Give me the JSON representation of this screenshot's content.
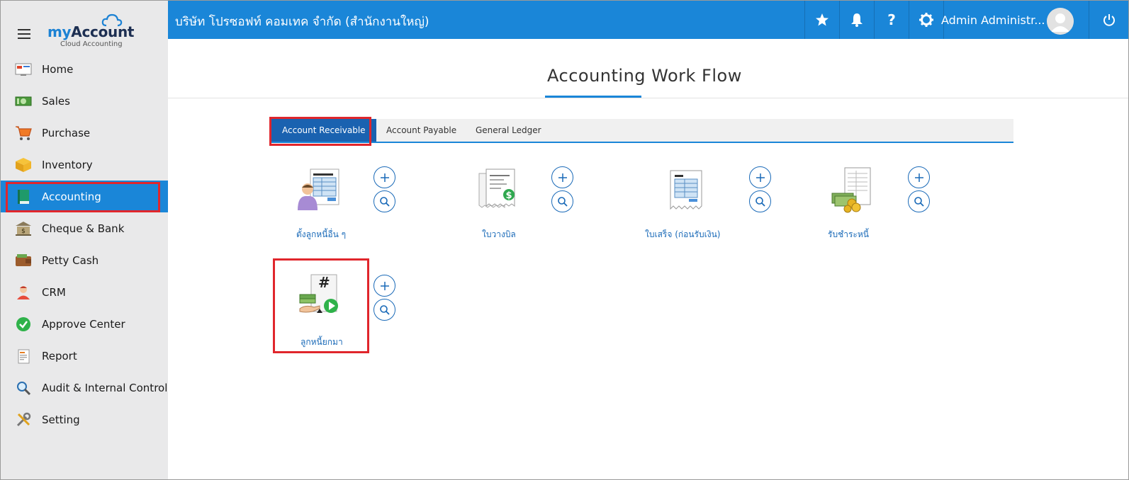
{
  "logo": {
    "brand_my": "my",
    "brand_account": "Account",
    "tagline": "Cloud Accounting"
  },
  "header": {
    "company": "บริษัท โปรซอฟท์ คอมเทค จำกัด (สำนักงานใหญ่)",
    "user_name": "Admin Administr...",
    "icons": [
      "star-icon",
      "bell-icon",
      "help-icon",
      "gear-icon",
      "power-icon"
    ]
  },
  "sidebar": {
    "items": [
      {
        "label": "Home",
        "icon": "home-icon"
      },
      {
        "label": "Sales",
        "icon": "money-icon"
      },
      {
        "label": "Purchase",
        "icon": "cart-icon"
      },
      {
        "label": "Inventory",
        "icon": "box-icon"
      },
      {
        "label": "Accounting",
        "icon": "book-icon",
        "active": true
      },
      {
        "label": "Cheque & Bank",
        "icon": "bank-icon"
      },
      {
        "label": "Petty Cash",
        "icon": "wallet-icon"
      },
      {
        "label": "CRM",
        "icon": "people-icon"
      },
      {
        "label": "Approve Center",
        "icon": "check-circle-icon"
      },
      {
        "label": "Report",
        "icon": "report-icon"
      },
      {
        "label": "Audit & Internal Control",
        "icon": "magnifier-icon"
      },
      {
        "label": "Setting",
        "icon": "tools-icon"
      }
    ]
  },
  "main": {
    "title": "Accounting Work Flow",
    "tabs": [
      {
        "label": "Account Receivable",
        "active": true
      },
      {
        "label": "Account Payable"
      },
      {
        "label": "General Ledger"
      }
    ],
    "workflow": [
      {
        "label": "ตั้งลูกหนี้อื่น ๆ",
        "icon": "person-document-icon"
      },
      {
        "label": "ใบวางบิล",
        "icon": "invoice-dollar-icon"
      },
      {
        "label": "ใบเสร็จ (ก่อนรับเงิน)",
        "icon": "receipt-icon"
      },
      {
        "label": "รับชำระหนี้",
        "icon": "money-document-icon"
      },
      {
        "label": "ลูกหนี้ยกมา",
        "icon": "hash-money-play-icon"
      }
    ]
  },
  "colors": {
    "primary": "#1a86d8",
    "tab_active": "#1a62b0",
    "highlight": "#e0262c",
    "link": "#1a6ab8",
    "sidebar_bg": "#e9e9ea"
  }
}
